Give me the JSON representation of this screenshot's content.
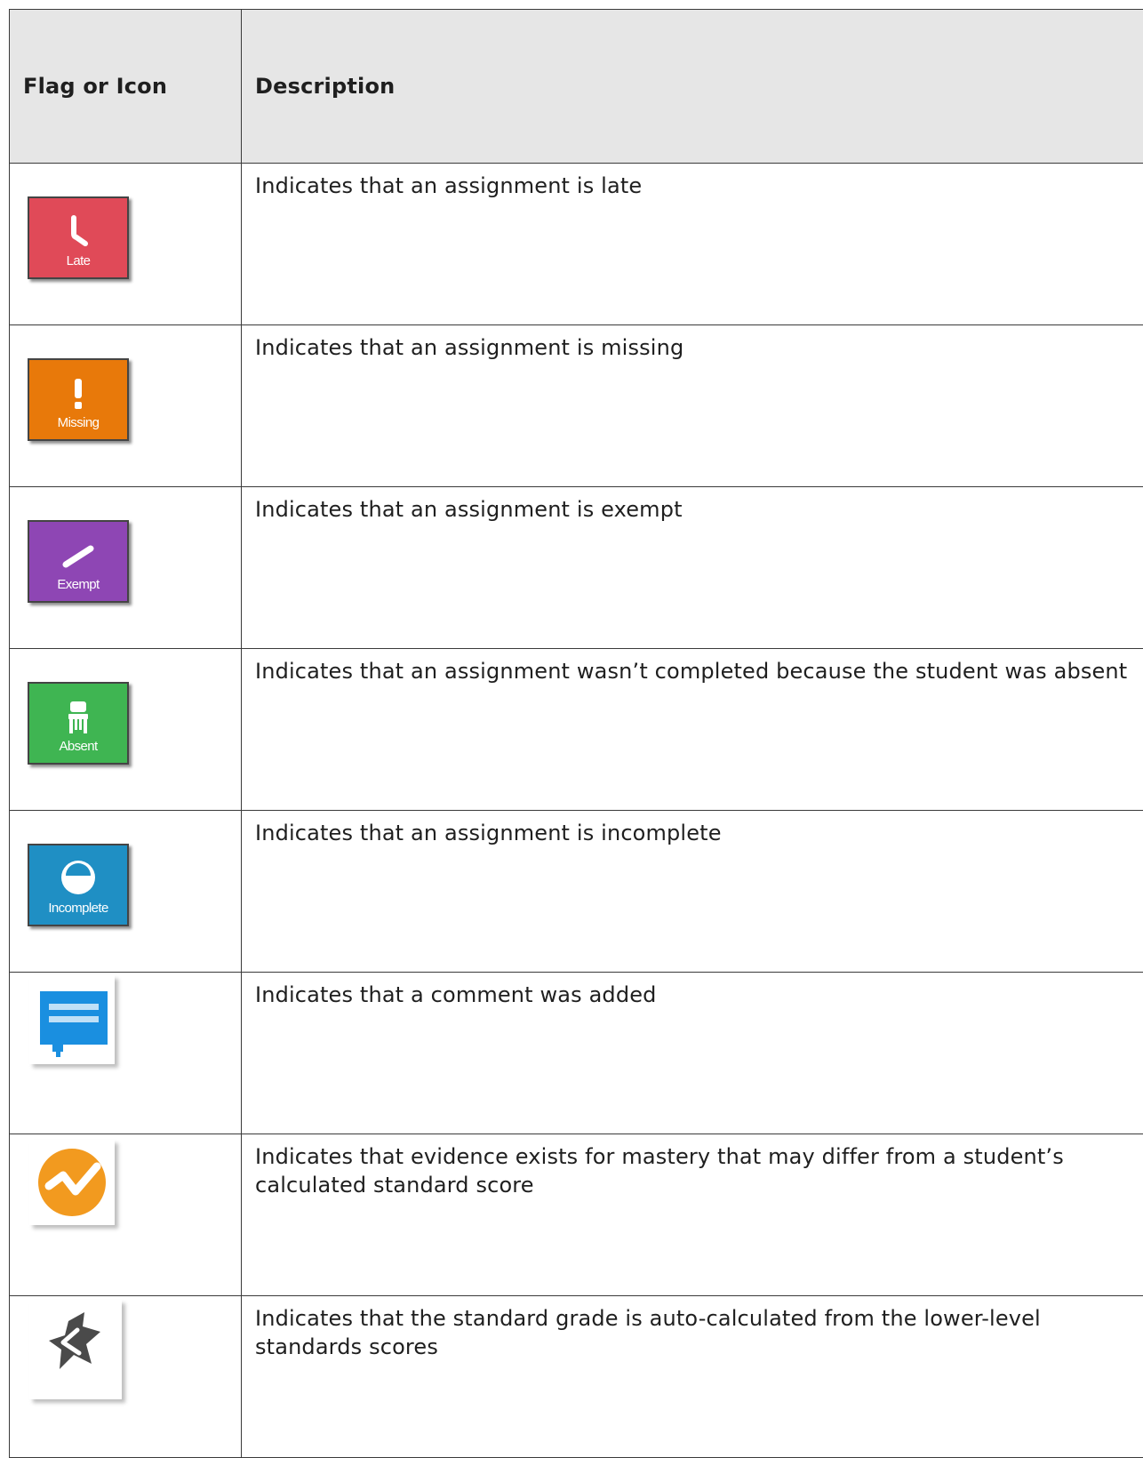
{
  "table": {
    "headers": {
      "icon": "Flag or Icon",
      "description": "Description"
    },
    "rows": [
      {
        "icon": "late-icon",
        "flag_label": "Late",
        "flag_color": "#e04a58",
        "description": "Indicates that an assignment is late"
      },
      {
        "icon": "missing-icon",
        "flag_label": "Missing",
        "flag_color": "#e8790a",
        "description": "Indicates that an assignment is missing"
      },
      {
        "icon": "exempt-icon",
        "flag_label": "Exempt",
        "flag_color": "#8e46b4",
        "description": "Indicates that an assignment is exempt"
      },
      {
        "icon": "absent-icon",
        "flag_label": "Absent",
        "flag_color": "#3fb552",
        "description": "Indicates that an assignment wasn’t completed because the student was absent"
      },
      {
        "icon": "incomplete-icon",
        "flag_label": "Incomplete",
        "flag_color": "#1f8fc4",
        "description": "Indicates that an assignment is incomplete"
      },
      {
        "icon": "comment-icon",
        "flag_color": "#1a8fe0",
        "description": "Indicates that a comment was added"
      },
      {
        "icon": "mastery-evidence-icon",
        "flag_color": "#f29a1f",
        "description": "Indicates that evidence exists for mastery that may differ from a student’s calculated standard score"
      },
      {
        "icon": "auto-calculated-icon",
        "flag_color": "#4a4a4a",
        "description": "Indicates that the standard grade is auto-calculated from the lower-level standards scores"
      }
    ]
  }
}
